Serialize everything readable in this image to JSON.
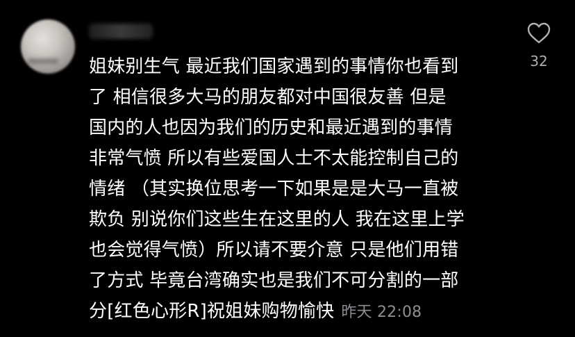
{
  "comment": {
    "lines": [
      "姐妹别生气 最近我们国家遇到的事情你也看到",
      "了 相信很多大马的朋友都对中国很友善  但是",
      "国内的人也因为我们的历史和最近遇到的事情",
      "非常气愤 所以有些爱国人士不太能控制自己的",
      "情绪 （其实换位思考一下如果是是大马一直被",
      "欺负 别说你们这些生在这里的人 我在这里上学",
      "也会觉得气愤）所以请不要介意 只是他们用错",
      "了方式 毕竟台湾确实也是我们不可分割的一部",
      "分[红色心形R]祝姐妹购物愉快"
    ],
    "timestamp": "昨天 22:08"
  },
  "like": {
    "icon": "heart-outline-icon",
    "count": "32"
  },
  "colors": {
    "background": "#000000",
    "text": "#ffffff",
    "muted": "#8e8e93"
  }
}
